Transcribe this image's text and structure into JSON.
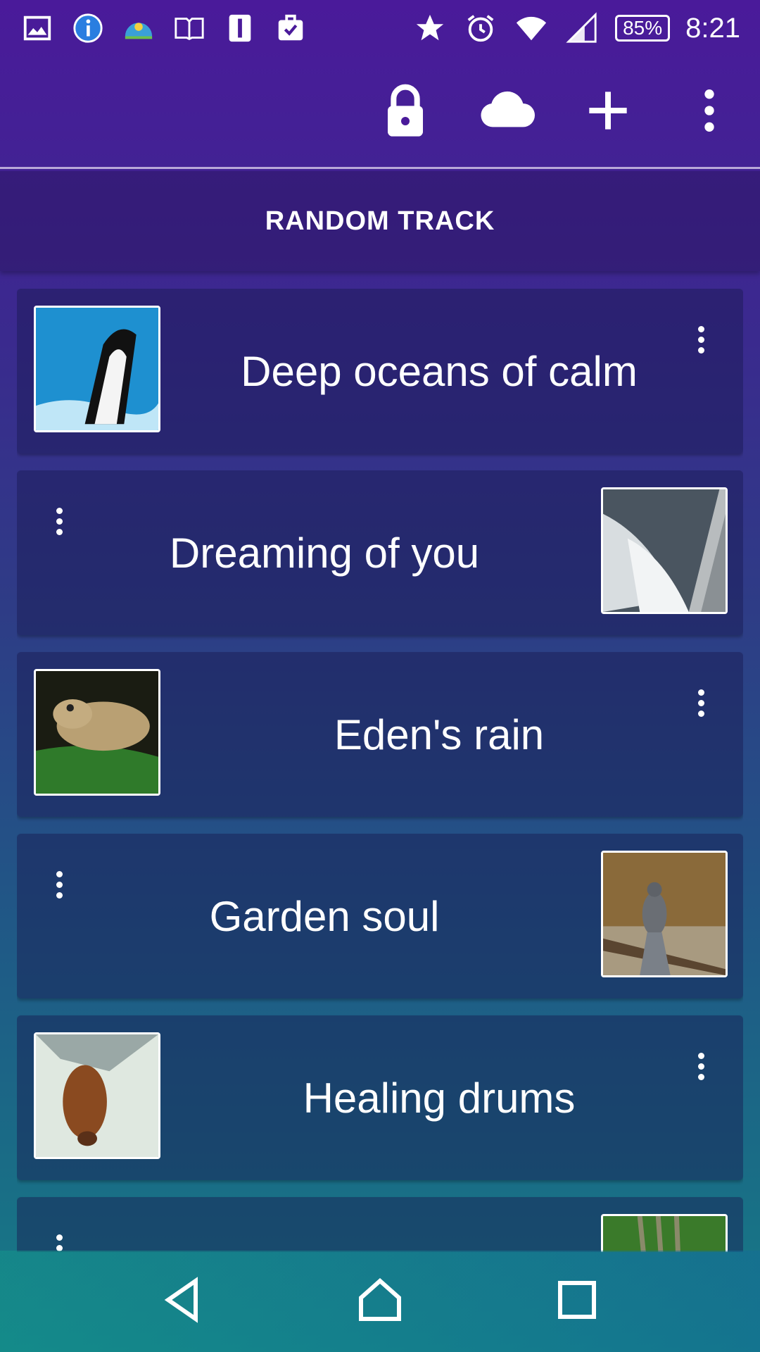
{
  "status_bar": {
    "left_icons": [
      "image-icon",
      "info-icon",
      "weather-icon",
      "book-icon",
      "tablet-icon",
      "briefcase-check-icon"
    ],
    "right_icons": [
      "star-icon",
      "alarm-icon",
      "wifi-icon",
      "signal-icon"
    ],
    "battery": "85%",
    "time": "8:21"
  },
  "toolbar": {
    "actions": [
      "lock-icon",
      "cloud-icon",
      "add-icon",
      "more-vert-icon"
    ]
  },
  "random_track_label": "RANDOM TRACK",
  "tracks": [
    {
      "title": "Deep oceans of calm",
      "image": "orca-thumbnail",
      "image_side": "left"
    },
    {
      "title": "Dreaming of you",
      "image": "water-spray-thumbnail",
      "image_side": "right"
    },
    {
      "title": "Eden's rain",
      "image": "frog-thumbnail",
      "image_side": "left"
    },
    {
      "title": "Garden soul",
      "image": "bird-thumbnail",
      "image_side": "right"
    },
    {
      "title": "Healing drums",
      "image": "bat-thumbnail",
      "image_side": "left"
    },
    {
      "title": "",
      "image": "bamboo-thumbnail",
      "image_side": "right"
    }
  ],
  "nav_bar": [
    "back-icon",
    "home-icon",
    "recents-icon"
  ]
}
